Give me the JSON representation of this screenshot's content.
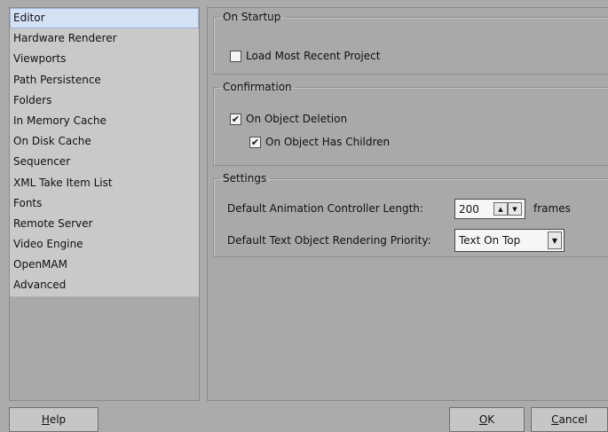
{
  "sidebar": {
    "items": [
      {
        "label": "Editor",
        "selected": true
      },
      {
        "label": "Hardware Renderer"
      },
      {
        "label": "Viewports"
      },
      {
        "label": "Path Persistence"
      },
      {
        "label": "Folders"
      },
      {
        "label": "In Memory Cache"
      },
      {
        "label": "On Disk Cache"
      },
      {
        "label": "Sequencer"
      },
      {
        "label": "XML Take Item List"
      },
      {
        "label": "Fonts"
      },
      {
        "label": "Remote Server"
      },
      {
        "label": "Video Engine"
      },
      {
        "label": "OpenMAM"
      },
      {
        "label": "Advanced"
      }
    ]
  },
  "startup": {
    "title": "On Startup",
    "load_recent": {
      "label": "Load Most Recent Project",
      "checked": false
    }
  },
  "confirmation": {
    "title": "Confirmation",
    "object_deletion": {
      "label": "On Object Deletion",
      "checked": true
    },
    "object_children": {
      "label": "On Object Has Children",
      "checked": true
    }
  },
  "settings": {
    "title": "Settings",
    "anim_length_label": "Default Animation Controller Length:",
    "anim_length_value": "200",
    "anim_length_units": "frames",
    "text_priority_label": "Default Text Object Rendering Priority:",
    "text_priority_value": "Text On Top"
  },
  "buttons": {
    "help_mnemonic": "H",
    "help_rest": "elp",
    "ok_mnemonic": "O",
    "ok_rest": "K",
    "cancel_mnemonic": "C",
    "cancel_rest": "ancel"
  }
}
